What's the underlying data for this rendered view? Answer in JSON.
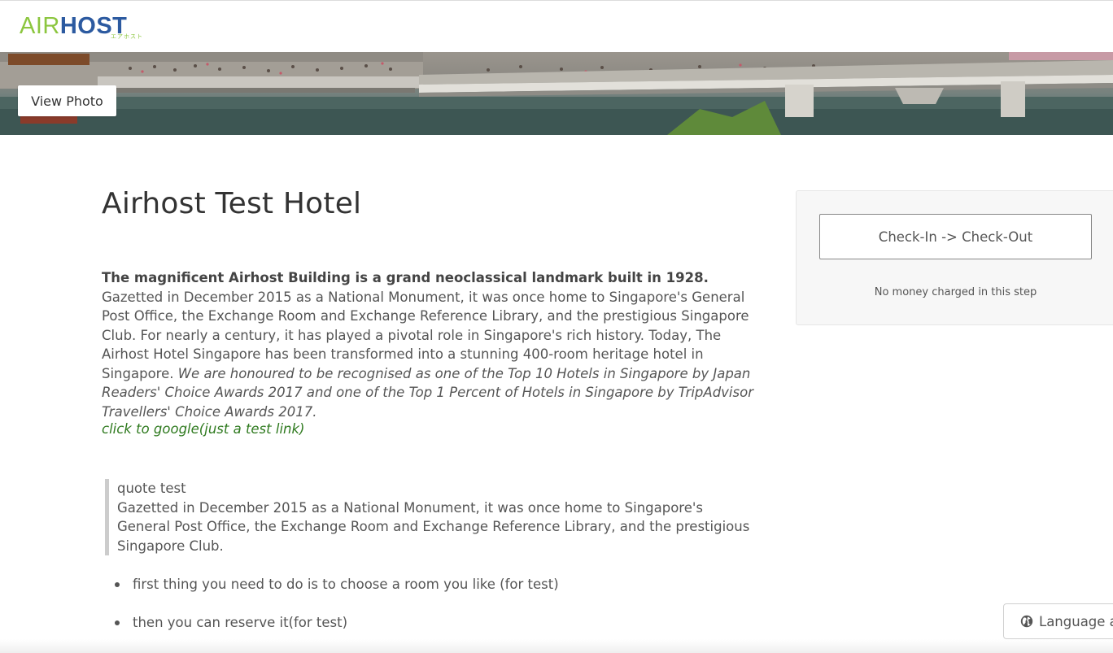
{
  "header": {
    "logo": {
      "part1": "AIR",
      "part2": "HOST",
      "katakana": "エアホスト",
      "colors": {
        "air": "#8cc63f",
        "host": "#2c5aa0"
      }
    }
  },
  "hero": {
    "view_photo_label": "View Photo"
  },
  "hotel": {
    "name": "Airhost Test Hotel",
    "description_bold": "The magnificent Airhost Building is a grand neoclassical landmark built in 1928.",
    "description_text": " Gazetted in December 2015 as a National Monument, it was once home to Singapore's General Post Office, the Exchange Room and Exchange Reference Library, and the prestigious Singapore Club. For nearly a century, it has played a pivotal role in Singapore's rich history. Today, The Airhost Hotel Singapore has been transformed into a stunning 400-room heritage hotel in Singapore. ",
    "description_italic": "We are honoured to be recognised as one of the Top 10 Hotels in Singapore by Japan Readers' Choice Awards 2017 and one of the Top 1 Percent of Hotels in Singapore by TripAdvisor Travellers' Choice Awards 2017.",
    "link_text": "click to google(just a test link)",
    "link_color": "#2f7a1f",
    "quote": {
      "title": "quote test",
      "body": "Gazetted in December 2015 as a National Monument, it was once home to Singapore's General Post Office, the Exchange Room and Exchange Reference Library, and the prestigious Singapore Club."
    },
    "steps": [
      "first thing you need to do is to choose a room you like (for test)",
      "then you can reserve it(for test)"
    ]
  },
  "booking": {
    "date_button_label": "Check-In -> Check-Out",
    "note": "No money charged in this step"
  },
  "language": {
    "label": "Language a",
    "icon": "globe-icon"
  }
}
